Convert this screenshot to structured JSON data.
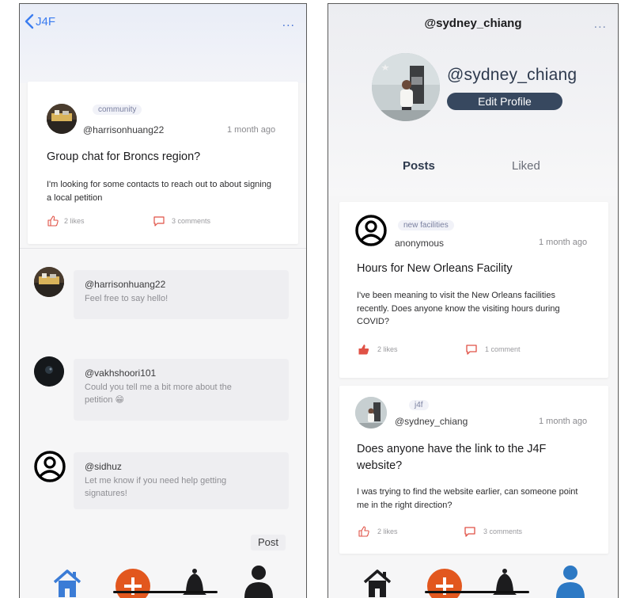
{
  "left": {
    "header": {
      "back_label": "J4F",
      "more": "..."
    },
    "post": {
      "tag": "community",
      "user": "@harrisonhuang22",
      "time": "1 month ago",
      "title": "Group chat for Broncs region?",
      "body": "I'm looking for some contacts to reach out to about signing a local petition",
      "likes": "2 likes",
      "comments": "3 comments"
    },
    "comments": [
      {
        "user": "@harrisonhuang22",
        "text": "Feel free to say hello!"
      },
      {
        "user": "@vakhshoori101",
        "text": "Could you tell me a bit more about the petition 😁"
      },
      {
        "user": "@sidhuz",
        "text": "Let me know if you need help getting signatures!"
      }
    ],
    "post_button": "Post"
  },
  "right": {
    "header": {
      "handle": "@sydney_chiang",
      "more": "..."
    },
    "profile": {
      "name": "@sydney_chiang",
      "edit_label": "Edit Profile"
    },
    "tabs": {
      "posts": "Posts",
      "liked": "Liked"
    },
    "posts": [
      {
        "tag": "new facilities",
        "user": "anonymous",
        "time": "1 month ago",
        "title": "Hours for New Orleans Facility",
        "body": "I've been meaning to visit the New Orleans facilities recently. Does anyone know the visiting hours during COVID?",
        "likes": "2 likes",
        "comments": "1 comment",
        "liked": true
      },
      {
        "tag": "j4f",
        "user": "@sydney_chiang",
        "time": "1 month ago",
        "title": "Does anyone have the link to the J4F website?",
        "body": "I was trying to find the website earlier, can someone point me in the right direction?",
        "likes": "2 likes",
        "comments": "3 comments",
        "liked": false
      }
    ]
  },
  "colors": {
    "accent_blue": "#3b7cf0",
    "navy": "#37485f",
    "orange": "#e2571e",
    "like_red": "#e05246",
    "tab_blue": "#2d79c4"
  },
  "icons": [
    "back-chevron-icon",
    "more-icon",
    "heart-like-icon",
    "comment-icon",
    "home-icon",
    "add-icon",
    "bell-icon",
    "profile-icon"
  ]
}
